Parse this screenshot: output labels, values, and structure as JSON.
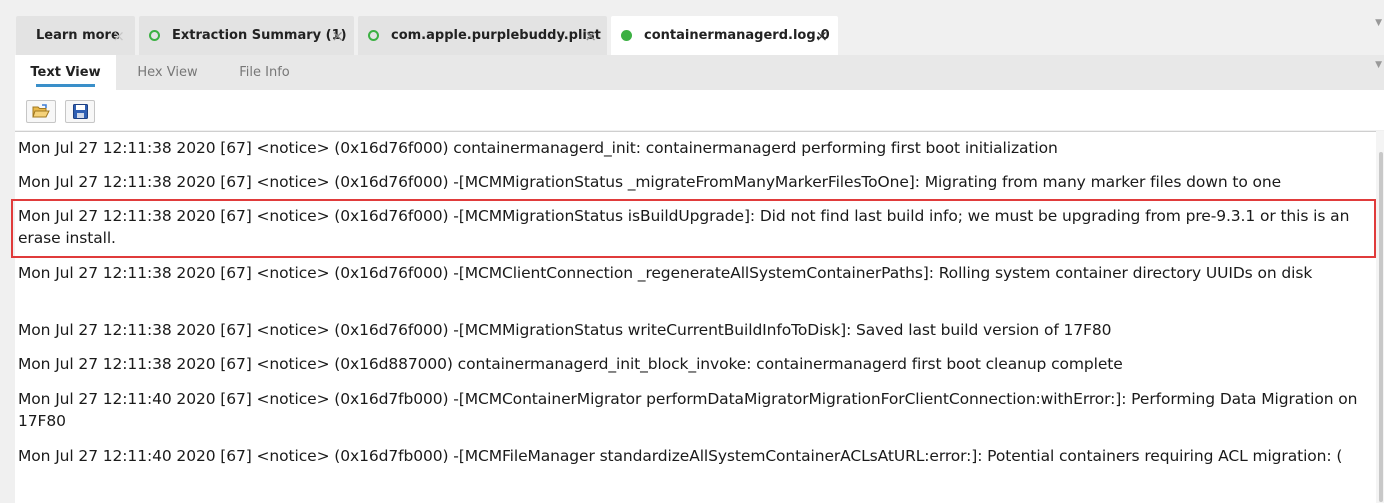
{
  "tabs": [
    {
      "label": "Learn more",
      "status": "none",
      "active": false
    },
    {
      "label": "Extraction Summary (1)",
      "status": "hollow",
      "active": false
    },
    {
      "label": "com.apple.purplebuddy.plist",
      "status": "hollow",
      "active": false
    },
    {
      "label": "containermanagerd.log.0",
      "status": "filled",
      "active": true
    }
  ],
  "tab_close_glyph": "×",
  "subtabs": [
    {
      "label": "Text View",
      "active": true
    },
    {
      "label": "Hex View",
      "active": false
    },
    {
      "label": "File Info",
      "active": false
    }
  ],
  "toolbar": {
    "open_icon": "folder-open-icon",
    "save_icon": "save-disk-icon"
  },
  "log_lines": [
    "Mon Jul 27 12:11:38 2020 [67] <notice> (0x16d76f000) containermanagerd_init: containermanagerd performing first boot initialization",
    "Mon Jul 27 12:11:38 2020 [67] <notice> (0x16d76f000) -[MCMMigrationStatus _migrateFromManyMarkerFilesToOne]: Migrating from many marker files down to one",
    "Mon Jul 27 12:11:38 2020 [67] <notice> (0x16d76f000) -[MCMMigrationStatus isBuildUpgrade]: Did not find last build info; we must be upgrading from pre-9.3.1 or this is an erase install.",
    "Mon Jul 27 12:11:38 2020 [67] <notice> (0x16d76f000) -[MCMClientConnection _regenerateAllSystemContainerPaths]: Rolling system container directory UUIDs on disk",
    "Mon Jul 27 12:11:38 2020 [67] <notice> (0x16d76f000) -[MCMMigrationStatus writeCurrentBuildInfoToDisk]: Saved last build version of 17F80",
    "Mon Jul 27 12:11:38 2020 [67] <notice> (0x16d887000) containermanagerd_init_block_invoke: containermanagerd first boot cleanup complete",
    "Mon Jul 27 12:11:40 2020 [67] <notice> (0x16d7fb000) -[MCMContainerMigrator performDataMigratorMigrationForClientConnection:withError:]: Performing Data Migration on 17F80",
    "Mon Jul 27 12:11:40 2020 [67] <notice> (0x16d7fb000) -[MCMFileManager standardizeAllSystemContainerACLsAtURL:error:]: Potential containers requiring ACL migration: ("
  ],
  "highlighted_line_index": 2,
  "colors": {
    "status_green": "#3cb043",
    "active_underline": "#3a8fc9",
    "highlight_border": "#e03b3b"
  }
}
